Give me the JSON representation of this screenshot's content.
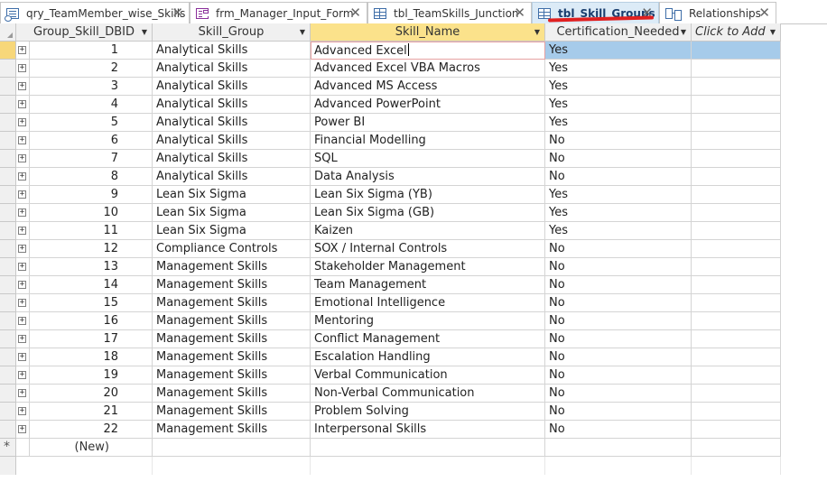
{
  "tabs": [
    {
      "label": "qry_TeamMember_wise_Skills",
      "icon": "query-icon",
      "close": "✕"
    },
    {
      "label": "frm_Manager_Input_Form",
      "icon": "form-icon",
      "close": "✕"
    },
    {
      "label": "tbl_TeamSkills_Junction",
      "icon": "table-icon",
      "close": "✕"
    },
    {
      "label": "tbl_Skill_Groups",
      "icon": "table-icon",
      "close": "✕",
      "active": true
    },
    {
      "label": "Relationships",
      "icon": "relationships-icon",
      "close": "✕"
    }
  ],
  "columns": [
    "Group_Skill_DBID",
    "Skill_Group",
    "Skill_Name",
    "Certification_Needed",
    "Click to Add"
  ],
  "rows": [
    {
      "id": "1",
      "group": "Analytical Skills",
      "skill": "Advanced Excel",
      "cert": "Yes"
    },
    {
      "id": "2",
      "group": "Analytical Skills",
      "skill": "Advanced Excel VBA Macros",
      "cert": "Yes"
    },
    {
      "id": "3",
      "group": "Analytical Skills",
      "skill": "Advanced MS Access",
      "cert": "Yes"
    },
    {
      "id": "4",
      "group": "Analytical Skills",
      "skill": "Advanced PowerPoint",
      "cert": "Yes"
    },
    {
      "id": "5",
      "group": "Analytical Skills",
      "skill": "Power BI",
      "cert": "Yes"
    },
    {
      "id": "6",
      "group": "Analytical Skills",
      "skill": "Financial Modelling",
      "cert": "No"
    },
    {
      "id": "7",
      "group": "Analytical Skills",
      "skill": "SQL",
      "cert": "No"
    },
    {
      "id": "8",
      "group": "Analytical Skills",
      "skill": "Data Analysis",
      "cert": "No"
    },
    {
      "id": "9",
      "group": "Lean Six Sigma",
      "skill": "Lean Six Sigma (YB)",
      "cert": "Yes"
    },
    {
      "id": "10",
      "group": "Lean Six Sigma",
      "skill": "Lean Six Sigma (GB)",
      "cert": "Yes"
    },
    {
      "id": "11",
      "group": "Lean Six Sigma",
      "skill": "Kaizen",
      "cert": "Yes"
    },
    {
      "id": "12",
      "group": "Compliance Controls",
      "skill": "SOX / Internal Controls",
      "cert": "No"
    },
    {
      "id": "13",
      "group": "Management Skills",
      "skill": "Stakeholder Management",
      "cert": "No"
    },
    {
      "id": "14",
      "group": "Management Skills",
      "skill": "Team Management",
      "cert": "No"
    },
    {
      "id": "15",
      "group": "Management Skills",
      "skill": "Emotional Intelligence",
      "cert": "No"
    },
    {
      "id": "16",
      "group": "Management Skills",
      "skill": "Mentoring",
      "cert": "No"
    },
    {
      "id": "17",
      "group": "Management Skills",
      "skill": "Conflict Management",
      "cert": "No"
    },
    {
      "id": "18",
      "group": "Management Skills",
      "skill": "Escalation Handling",
      "cert": "No"
    },
    {
      "id": "19",
      "group": "Management Skills",
      "skill": "Verbal Communication",
      "cert": "No"
    },
    {
      "id": "20",
      "group": "Management Skills",
      "skill": "Non-Verbal Communication",
      "cert": "No"
    },
    {
      "id": "21",
      "group": "Management Skills",
      "skill": "Problem Solving",
      "cert": "No"
    },
    {
      "id": "22",
      "group": "Management Skills",
      "skill": "Interpersonal Skills",
      "cert": "No"
    }
  ],
  "new_record_label": "(New)",
  "new_record_marker": "*",
  "expander_glyph": "+",
  "colors": {
    "active_tab": "#dcebf7",
    "selected_header": "#fbe28b",
    "current_record_selector": "#f7d77a",
    "selected_cell": "#a6cbea",
    "annotation_underline": "#e02020"
  }
}
